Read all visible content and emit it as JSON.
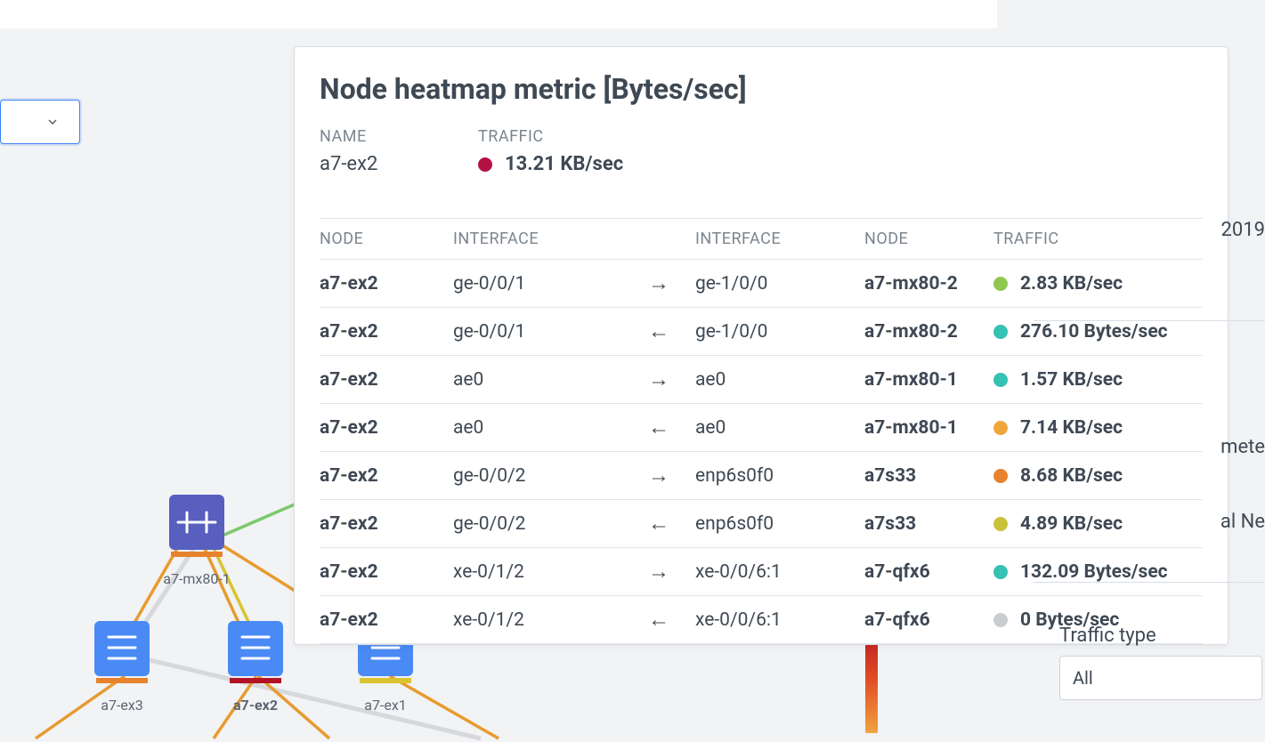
{
  "tooltip": {
    "title": "Node heatmap metric [Bytes/sec]",
    "labels": {
      "name": "NAME",
      "traffic": "TRAFFIC",
      "node": "NODE",
      "interface": "INTERFACE"
    },
    "node_name": "a7-ex2",
    "node_traffic": {
      "color": "#b31243",
      "value": "13.21 KB/sec"
    },
    "rows": [
      {
        "n1": "a7-ex2",
        "if1": "ge-0/0/1",
        "dir": "right",
        "if2": "ge-1/0/0",
        "n2": "a7-mx80-2",
        "color": "#8fc850",
        "traffic": "2.83 KB/sec"
      },
      {
        "n1": "a7-ex2",
        "if1": "ge-0/0/1",
        "dir": "left",
        "if2": "ge-1/0/0",
        "n2": "a7-mx80-2",
        "color": "#35c1b3",
        "traffic": "276.10 Bytes/sec"
      },
      {
        "n1": "a7-ex2",
        "if1": "ae0",
        "dir": "right",
        "if2": "ae0",
        "n2": "a7-mx80-1",
        "color": "#35c1b3",
        "traffic": "1.57 KB/sec"
      },
      {
        "n1": "a7-ex2",
        "if1": "ae0",
        "dir": "left",
        "if2": "ae0",
        "n2": "a7-mx80-1",
        "color": "#f0a63a",
        "traffic": "7.14 KB/sec"
      },
      {
        "n1": "a7-ex2",
        "if1": "ge-0/0/2",
        "dir": "right",
        "if2": "enp6s0f0",
        "n2": "a7s33",
        "color": "#e8832d",
        "traffic": "8.68 KB/sec"
      },
      {
        "n1": "a7-ex2",
        "if1": "ge-0/0/2",
        "dir": "left",
        "if2": "enp6s0f0",
        "n2": "a7s33",
        "color": "#c8c23a",
        "traffic": "4.89 KB/sec"
      },
      {
        "n1": "a7-ex2",
        "if1": "xe-0/1/2",
        "dir": "right",
        "if2": "xe-0/0/6:1",
        "n2": "a7-qfx6",
        "color": "#35c1b3",
        "traffic": "132.09 Bytes/sec"
      },
      {
        "n1": "a7-ex2",
        "if1": "xe-0/1/2",
        "dir": "left",
        "if2": "xe-0/0/6:1",
        "n2": "a7-qfx6",
        "color": "#c9cdd2",
        "traffic": "0 Bytes/sec"
      }
    ]
  },
  "topology": {
    "nodes": {
      "mx80_1": "a7-mx80-1",
      "ex3": "a7-ex3",
      "ex2": "a7-ex2",
      "ex1": "a7-ex1"
    }
  },
  "right_panel": {
    "year_frag": "2019",
    "label_frag1": "mete",
    "label_frag2": "al Ne",
    "traffic_type_label": "Traffic type",
    "traffic_type_value": "All"
  }
}
